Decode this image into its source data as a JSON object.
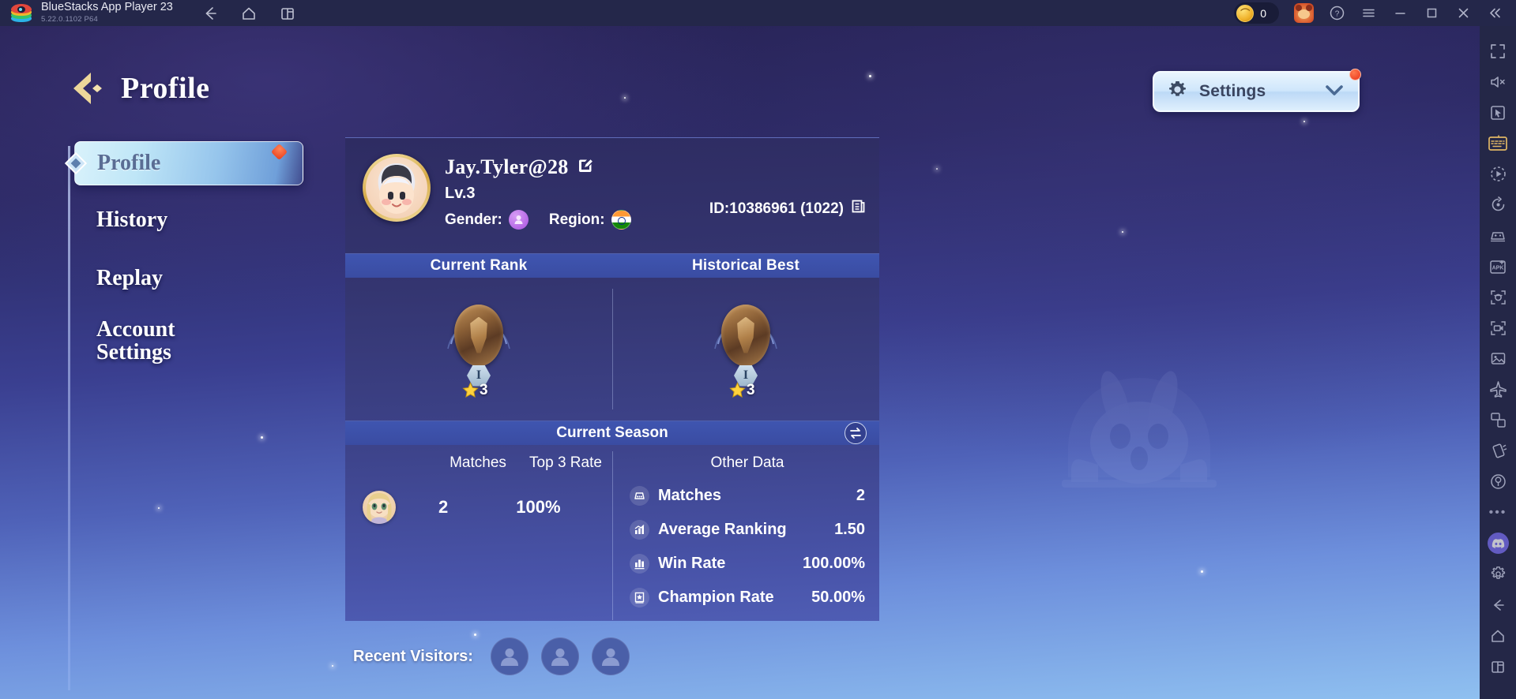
{
  "titlebar": {
    "app_name": "BlueStacks App Player 23",
    "version": "5.22.0.1102  P64",
    "logo_icon": "bluestacks-logo",
    "nav": [
      {
        "icon": "back-arrow-icon",
        "name": "back"
      },
      {
        "icon": "home-icon",
        "name": "home"
      },
      {
        "icon": "multi-instance-icon",
        "name": "multi-instance"
      }
    ],
    "coins": "0",
    "coin_icon": "coin-icon",
    "account_icon": "bear-avatar-icon",
    "help_icon": "help-circle-icon",
    "menu_icon": "hamburger-menu-icon",
    "minimize_icon": "minimize-icon",
    "maximize_icon": "maximize-icon",
    "close_icon": "close-icon",
    "collapse_icon": "double-chevron-left-icon"
  },
  "right_toolbar": {
    "items": [
      {
        "name": "fullscreen-icon"
      },
      {
        "name": "mute-icon"
      },
      {
        "name": "cursor-pointer-icon"
      },
      {
        "name": "keyboard-controls-icon",
        "highlighted": true
      },
      {
        "name": "macro-play-icon"
      },
      {
        "name": "sync-rotate-icon"
      },
      {
        "name": "game-controls-icon"
      },
      {
        "name": "install-apk-icon"
      },
      {
        "name": "screenshot-icon"
      },
      {
        "name": "record-video-icon"
      },
      {
        "name": "media-manager-icon"
      },
      {
        "name": "airplane-icon"
      },
      {
        "name": "rotate-screen-icon"
      },
      {
        "name": "shake-icon"
      },
      {
        "name": "location-icon"
      },
      {
        "name": "more-options-icon"
      },
      {
        "name": "discord-icon"
      },
      {
        "name": "settings-gear-icon"
      },
      {
        "name": "android-back-icon"
      },
      {
        "name": "android-home-icon"
      },
      {
        "name": "android-recents-icon"
      }
    ]
  },
  "header": {
    "back_icon": "back-chevron-icon",
    "title": "Profile"
  },
  "settings_button": {
    "label": "Settings",
    "gear_icon": "gear-icon",
    "chevron_icon": "chevron-down-icon",
    "has_notification": true
  },
  "sidebar": {
    "items": [
      {
        "label": "Profile",
        "active": true,
        "badge": true
      },
      {
        "label": "History",
        "active": false,
        "badge": false
      },
      {
        "label": "Replay",
        "active": false,
        "badge": false
      },
      {
        "label": "Account Settings",
        "active": false,
        "badge": false
      }
    ]
  },
  "profile": {
    "username": "Jay.Tyler@28",
    "edit_icon": "edit-pencil-icon",
    "level": "Lv.3",
    "gender_label": "Gender:",
    "gender_icon": "female-avatar-icon",
    "region_label": "Region:",
    "region_icon": "india-flag-icon",
    "id_text": "ID:10386961 (1022)",
    "copy_icon": "copy-icon",
    "avatar_icon": "player-avatar"
  },
  "rank": {
    "headers": [
      "Current Rank",
      "Historical Best"
    ],
    "current": {
      "tier": "I",
      "stars": "3",
      "emblem_icon": "bronze-helmet-emblem"
    },
    "best": {
      "tier": "I",
      "stars": "3",
      "emblem_icon": "bronze-helmet-emblem"
    }
  },
  "season": {
    "title": "Current Season",
    "swap_icon": "swap-arrows-icon",
    "left_headers": [
      "",
      "Matches",
      "Top 3 Rate"
    ],
    "left_values": {
      "matches": "2",
      "top3_rate": "100%",
      "character_icon": "character-avatar"
    },
    "right_title": "Other Data",
    "stats": [
      {
        "icon": "matches-icon",
        "label": "Matches",
        "value": "2"
      },
      {
        "icon": "ranking-icon",
        "label": "Average Ranking",
        "value": "1.50"
      },
      {
        "icon": "winrate-icon",
        "label": "Win Rate",
        "value": "100.00%"
      },
      {
        "icon": "champion-icon",
        "label": "Champion Rate",
        "value": "50.00%"
      }
    ]
  },
  "visitors": {
    "label": "Recent Visitors:",
    "slots": [
      {
        "icon": "visitor-placeholder-icon"
      },
      {
        "icon": "visitor-placeholder-icon"
      },
      {
        "icon": "visitor-placeholder-icon"
      }
    ]
  },
  "colors": {
    "titlebar_bg": "#24274a",
    "toolbar_bg": "#242747",
    "card_top": "#2e2c62",
    "card_bottom": "#4f5db4",
    "band_blue": "#3f55b0",
    "accent_gold": "#e4c373",
    "notification_red": "#ea3a16",
    "discord_purple": "#7b6ff0"
  },
  "watermark": {
    "icon": "bunny-mascot-watermark"
  }
}
